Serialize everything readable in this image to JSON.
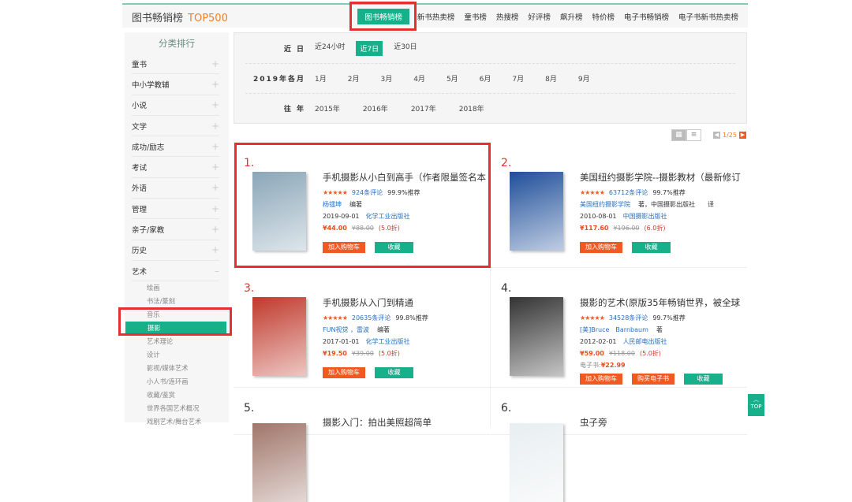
{
  "header": {
    "title": "图书畅销榜",
    "top": "TOP500",
    "nav": [
      "图书畅销榜",
      "新书热卖榜",
      "童书榜",
      "热搜榜",
      "好评榜",
      "飙升榜",
      "特价榜",
      "电子书畅销榜",
      "电子书新书热卖榜"
    ],
    "active_nav": "图书畅销榜"
  },
  "sidebar": {
    "title": "分类排行",
    "items": [
      "童书",
      "中小学教辅",
      "小说",
      "文学",
      "成功/励志",
      "考试",
      "外语",
      "管理",
      "亲子/家教",
      "历史"
    ],
    "expanded": "艺术",
    "subitems": [
      "绘画",
      "书法/篆刻",
      "音乐",
      "摄影",
      "艺术理论",
      "设计",
      "影视/媒体艺术",
      "小人书/连环画",
      "收藏/鉴赏",
      "世界各国艺术概况",
      "戏剧艺术/舞台艺术"
    ],
    "selected": "摄影"
  },
  "filters": {
    "recent": {
      "label": "近 日",
      "options": [
        "近24小时",
        "近7日",
        "近30日"
      ],
      "selected": "近7日"
    },
    "months": {
      "label": "2019年各月",
      "options": [
        "1月",
        "2月",
        "3月",
        "4月",
        "5月",
        "6月",
        "7月",
        "8月",
        "9月"
      ]
    },
    "years": {
      "label": "往 年",
      "options": [
        "2015年",
        "2016年",
        "2017年",
        "2018年"
      ]
    }
  },
  "toolbar": {
    "page": "1/25",
    "view": "grid"
  },
  "buttons": {
    "cart": "加入购物车",
    "fav": "收藏",
    "ebook": "购买电子书",
    "top": "TOP"
  },
  "books": [
    {
      "rank": "1.",
      "title": "手机摄影从小白到高手（作者限量签名本",
      "rating": 5,
      "reviews": "924条评论",
      "recommend": "99.9%推荐",
      "author": "杨镭坤",
      "role": "编著",
      "date": "2019-09-01",
      "publisher": "化学工业出版社",
      "price": "¥44.00",
      "orig": "¥88.00",
      "discount": "(5.0折)",
      "cover": "#8aa6b8"
    },
    {
      "rank": "2.",
      "title": "美国纽约摄影学院--摄影教材（最新修订",
      "rating": 5,
      "reviews": "63712条评论",
      "recommend": "99.7%推荐",
      "author": "美国纽约摄影学院",
      "role": "著，中国摄影出版社　　译",
      "date": "2010-08-01",
      "publisher": "中国摄影出版社",
      "price": "¥117.60",
      "orig": "¥196.00",
      "discount": "(6.0折)",
      "cover": "#1f4f9a"
    },
    {
      "rank": "3.",
      "title": "手机摄影从入门到精通",
      "rating": 5,
      "reviews": "20635条评论",
      "recommend": "99.8%推荐",
      "author": "FUN视觉 ，雷波",
      "role": "编著",
      "date": "2017-01-01",
      "publisher": "化学工业出版社",
      "price": "¥19.50",
      "orig": "¥39.00",
      "discount": "(5.0折)",
      "cover": "#c0392b"
    },
    {
      "rank": "4.",
      "title": "摄影的艺术(原版35年畅销世界，被全球",
      "rating": 5,
      "reviews": "34528条评论",
      "recommend": "99.7%推荐",
      "author": "[美]Bruce　Barnbaum",
      "role": "著",
      "date": "2012-02-01",
      "publisher": "人民邮电出版社",
      "price": "¥59.00",
      "orig": "¥118.00",
      "discount": "(5.0折)",
      "ebook_label": "电子书:",
      "ebook_price": "¥22.99",
      "cover": "#333333"
    },
    {
      "rank": "5.",
      "title": "摄影入门：拍出美照超简单",
      "cover": "#a0766a"
    },
    {
      "rank": "6.",
      "title": "虫子旁",
      "cover": "#e8eef0"
    }
  ]
}
